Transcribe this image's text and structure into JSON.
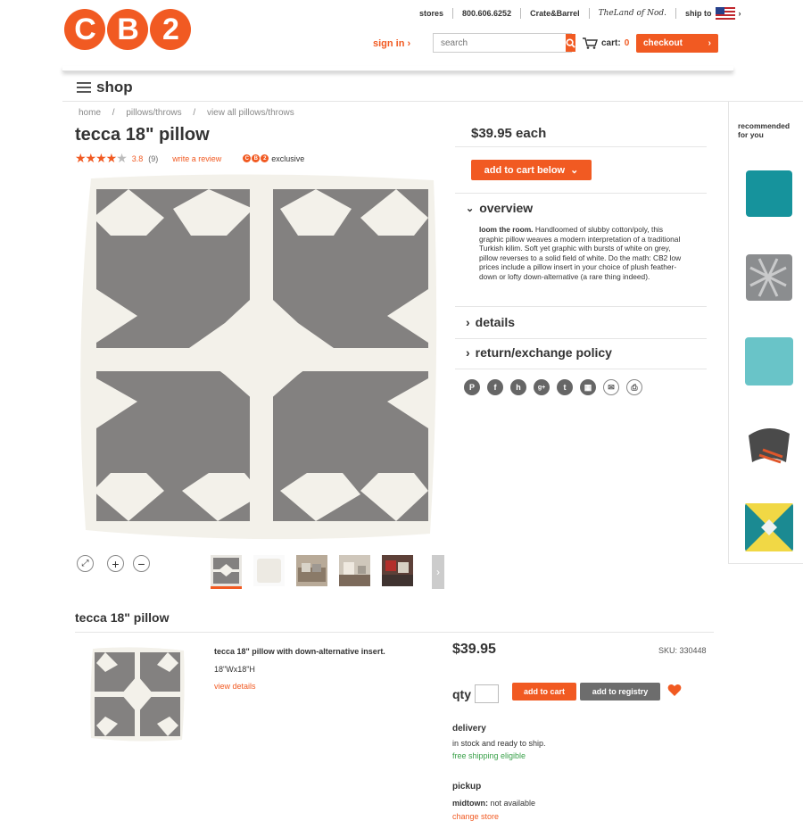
{
  "header": {
    "logo_letters": [
      "C",
      "B",
      "2"
    ],
    "top_links": [
      "stores",
      "800.606.6252",
      "Crate&Barrel",
      "TheLand of Nod.",
      "ship to"
    ],
    "sign_in": "sign in",
    "search_placeholder": "search",
    "cart_label": "cart:",
    "cart_count": "0",
    "checkout": "checkout"
  },
  "nav": {
    "shop": "shop"
  },
  "breadcrumbs": [
    "home",
    "pillows/throws",
    "view all pillows/throws"
  ],
  "product": {
    "title": "tecca 18\" pillow",
    "stars_filled": 3.8,
    "rating": "3.8",
    "review_count": "(9)",
    "write_review": "write a review",
    "exclusive": "exclusive",
    "price_each": "$39.95 each",
    "add_to_cart_below": "add to cart below"
  },
  "overview": {
    "heading": "overview",
    "lead": "loom the room.",
    "body": " Handloomed of slubby cotton/poly, this graphic pillow weaves a modern interpretation of a traditional Turkish kilim. Soft yet graphic with bursts of white on grey, pillow reverses to a solid field of white. Do the math: CB2 low prices include a pillow insert in your choice of plush feather-down or lofty down-alternative (a rare thing indeed)."
  },
  "accordion": {
    "details": "details",
    "return_policy": "return/exchange policy"
  },
  "social_icons": [
    "pinterest-icon",
    "facebook-icon",
    "houzz-icon",
    "googleplus-icon",
    "twitter-icon",
    "grid-icon",
    "email-icon",
    "print-icon"
  ],
  "recommended": {
    "heading": "recommended for you"
  },
  "colors": {
    "brand": "#f15a22",
    "grey_pillow": "#838180",
    "cream": "#f3f1ea"
  },
  "bottom": {
    "title": "tecca 18\" pillow",
    "item_name": "tecca 18\" pillow with down-alternative insert.",
    "dims": "18\"Wx18\"H",
    "view_details": "view details",
    "price": "$39.95",
    "sku": "SKU: 330448",
    "qty_label": "qty",
    "add_to_cart": "add to cart",
    "add_to_registry": "add to registry",
    "delivery_label": "delivery",
    "delivery_text": "in stock and ready to ship.",
    "free_shipping": "free shipping eligible",
    "pickup_label": "pickup",
    "pickup_store": "midtown:",
    "pickup_status": " not available",
    "change_store": "change store"
  }
}
